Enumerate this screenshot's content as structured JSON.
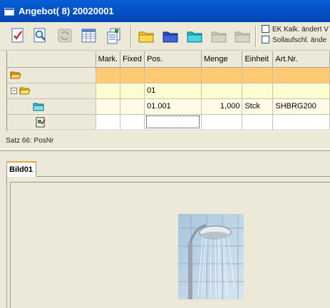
{
  "window": {
    "title": "Angebot( 8) 20020001"
  },
  "toolbar": {
    "buttons": [
      {
        "name": "checklist-button",
        "icon": "checklist-icon"
      },
      {
        "name": "preview-button",
        "icon": "magnifier-icon"
      },
      {
        "name": "refresh-button",
        "icon": "refresh-icon",
        "disabled": true
      },
      {
        "name": "table-button",
        "icon": "table-icon"
      },
      {
        "name": "copy-document-button",
        "icon": "documents-icon"
      },
      {
        "name": "yellow-folder-button",
        "icon": "folder-yellow-icon"
      },
      {
        "name": "blue-folder-button",
        "icon": "folder-blue-icon"
      },
      {
        "name": "cyan-folder-button",
        "icon": "folder-cyan-icon"
      },
      {
        "name": "gray-folder-button",
        "icon": "folder-gray-icon",
        "disabled": true
      },
      {
        "name": "gray-folder-2-button",
        "icon": "folder-gray-icon",
        "disabled": true
      }
    ],
    "checkboxes": [
      {
        "label": "EK Kalk. ändert V",
        "checked": false
      },
      {
        "label": "Sollaufschl. ände",
        "checked": false
      }
    ]
  },
  "grid": {
    "columns": [
      "",
      "Mark.",
      "Fixed",
      "Pos.",
      "Menge",
      "Einheit",
      "Art.Nr."
    ],
    "rows": [
      {
        "mark": "",
        "fixed": "",
        "pos": "",
        "menge": "",
        "einheit": "",
        "artnr": ""
      },
      {
        "mark": "",
        "fixed": "",
        "pos": "01",
        "menge": "",
        "einheit": "",
        "artnr": ""
      },
      {
        "mark": "",
        "fixed": "",
        "pos": "01.001",
        "menge": "1,000",
        "einheit": "Stck",
        "artnr": "SHBRG200"
      },
      {
        "mark": "",
        "fixed": "",
        "pos": "",
        "menge": "",
        "einheit": "",
        "artnr": ""
      }
    ]
  },
  "status": {
    "text": "Satz 66: PosNr"
  },
  "tabs": [
    {
      "label": "Bild01",
      "active": true
    }
  ],
  "colors": {
    "title_bar": "#0553c9",
    "row_folder": "#ffca73",
    "row_group": "#fffbd0",
    "row_item": "#fffbe6",
    "tab_highlight": "#f0a43c"
  }
}
